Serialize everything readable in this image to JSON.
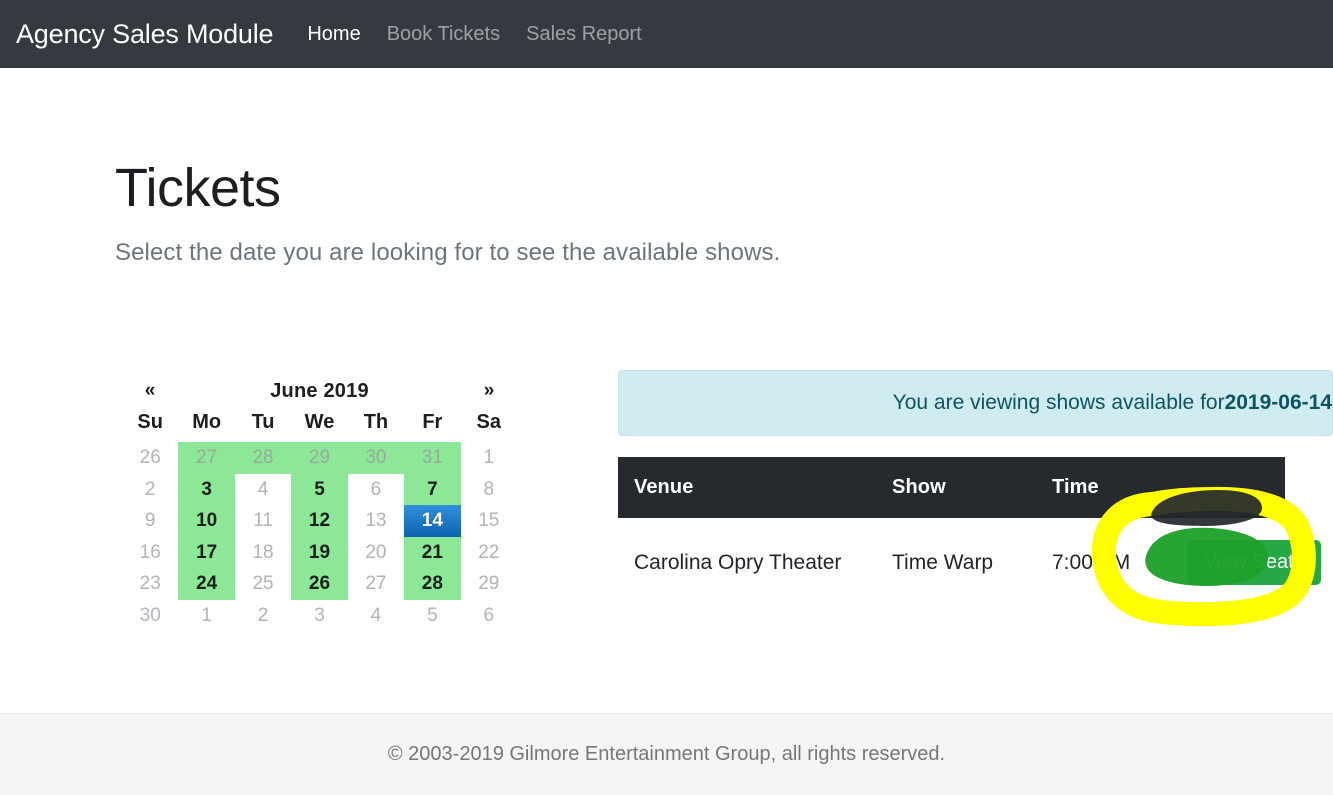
{
  "navbar": {
    "brand": "Agency Sales Module",
    "links": [
      {
        "label": "Home",
        "active": true
      },
      {
        "label": "Book Tickets",
        "active": false
      },
      {
        "label": "Sales Report",
        "active": false
      }
    ]
  },
  "main": {
    "title": "Tickets",
    "lead": "Select the date you are looking for to see the available shows."
  },
  "calendar": {
    "prev_icon": "«",
    "next_icon": "»",
    "month_title": "June 2019",
    "weekdays": [
      "Su",
      "Mo",
      "Tu",
      "We",
      "Th",
      "Fr",
      "Sa"
    ],
    "selected_date": "14",
    "available_color": "#8ce896",
    "selected_color": "#0b63b0",
    "weeks": [
      [
        {
          "day": "26",
          "state": "outside"
        },
        {
          "day": "27",
          "state": "outside-available"
        },
        {
          "day": "28",
          "state": "outside-available"
        },
        {
          "day": "29",
          "state": "outside-available"
        },
        {
          "day": "30",
          "state": "outside-available"
        },
        {
          "day": "31",
          "state": "outside-available"
        },
        {
          "day": "1",
          "state": "disabled"
        }
      ],
      [
        {
          "day": "2",
          "state": "disabled"
        },
        {
          "day": "3",
          "state": "available"
        },
        {
          "day": "4",
          "state": "disabled"
        },
        {
          "day": "5",
          "state": "available"
        },
        {
          "day": "6",
          "state": "disabled"
        },
        {
          "day": "7",
          "state": "available"
        },
        {
          "day": "8",
          "state": "disabled"
        }
      ],
      [
        {
          "day": "9",
          "state": "disabled"
        },
        {
          "day": "10",
          "state": "available"
        },
        {
          "day": "11",
          "state": "disabled"
        },
        {
          "day": "12",
          "state": "available"
        },
        {
          "day": "13",
          "state": "disabled"
        },
        {
          "day": "14",
          "state": "selected"
        },
        {
          "day": "15",
          "state": "disabled"
        }
      ],
      [
        {
          "day": "16",
          "state": "disabled"
        },
        {
          "day": "17",
          "state": "available"
        },
        {
          "day": "18",
          "state": "disabled"
        },
        {
          "day": "19",
          "state": "available"
        },
        {
          "day": "20",
          "state": "disabled"
        },
        {
          "day": "21",
          "state": "available"
        },
        {
          "day": "22",
          "state": "disabled"
        }
      ],
      [
        {
          "day": "23",
          "state": "disabled"
        },
        {
          "day": "24",
          "state": "available"
        },
        {
          "day": "25",
          "state": "disabled"
        },
        {
          "day": "26",
          "state": "available"
        },
        {
          "day": "27",
          "state": "disabled"
        },
        {
          "day": "28",
          "state": "available"
        },
        {
          "day": "29",
          "state": "disabled"
        }
      ],
      [
        {
          "day": "30",
          "state": "outside"
        },
        {
          "day": "1",
          "state": "outside"
        },
        {
          "day": "2",
          "state": "outside"
        },
        {
          "day": "3",
          "state": "outside"
        },
        {
          "day": "4",
          "state": "outside"
        },
        {
          "day": "5",
          "state": "outside"
        },
        {
          "day": "6",
          "state": "outside"
        }
      ]
    ]
  },
  "alert": {
    "prefix": "You are viewing shows available for ",
    "date": "2019-06-14"
  },
  "table": {
    "headers": [
      "Venue",
      "Show",
      "Time",
      ""
    ],
    "rows": [
      {
        "venue": "Carolina Opry Theater",
        "show": "Time Warp",
        "time": "7:00 PM",
        "action_label": "View Seats"
      }
    ]
  },
  "annotation": {
    "highlight_color": "#ffff00",
    "smudge_color": "#1ea02a"
  },
  "footer": {
    "text": "© 2003-2019 Gilmore Entertainment Group, all rights reserved."
  }
}
